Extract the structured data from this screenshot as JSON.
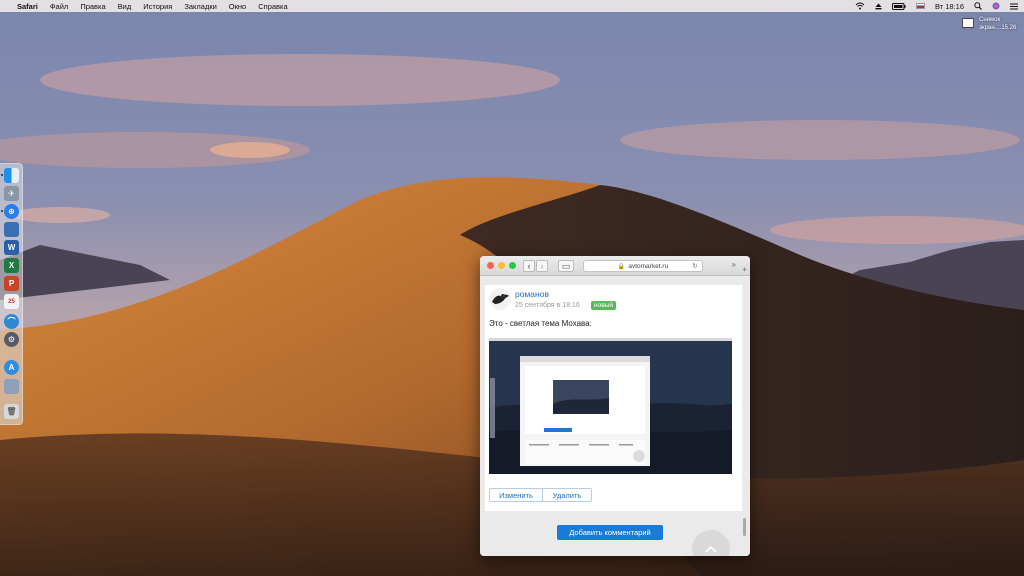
{
  "menubar": {
    "app": "Safari",
    "items": [
      "Файл",
      "Правка",
      "Вид",
      "История",
      "Закладки",
      "Окно",
      "Справка"
    ],
    "clock": "Вт 18:16"
  },
  "desktop_file": {
    "line1": "Снимок",
    "line2": "экран....15.26"
  },
  "safari": {
    "url": "avtomarket.ru",
    "comment": {
      "author": "романов",
      "date": "25 сентября в 18:16",
      "badge": "новый",
      "text": "Это - светлая тема Мохава:"
    },
    "edit_label": "Изменить",
    "delete_label": "Удалить",
    "add_comment_label": "Добавить комментарий"
  },
  "colors": {
    "link": "#1e6fc4",
    "badge": "#5cb85c",
    "primary_button": "#1b7ad6"
  },
  "icons": [
    "apple-icon",
    "wifi-icon",
    "eject-icon",
    "battery-icon",
    "search-icon",
    "siri-icon",
    "screenshot-file-icon"
  ]
}
